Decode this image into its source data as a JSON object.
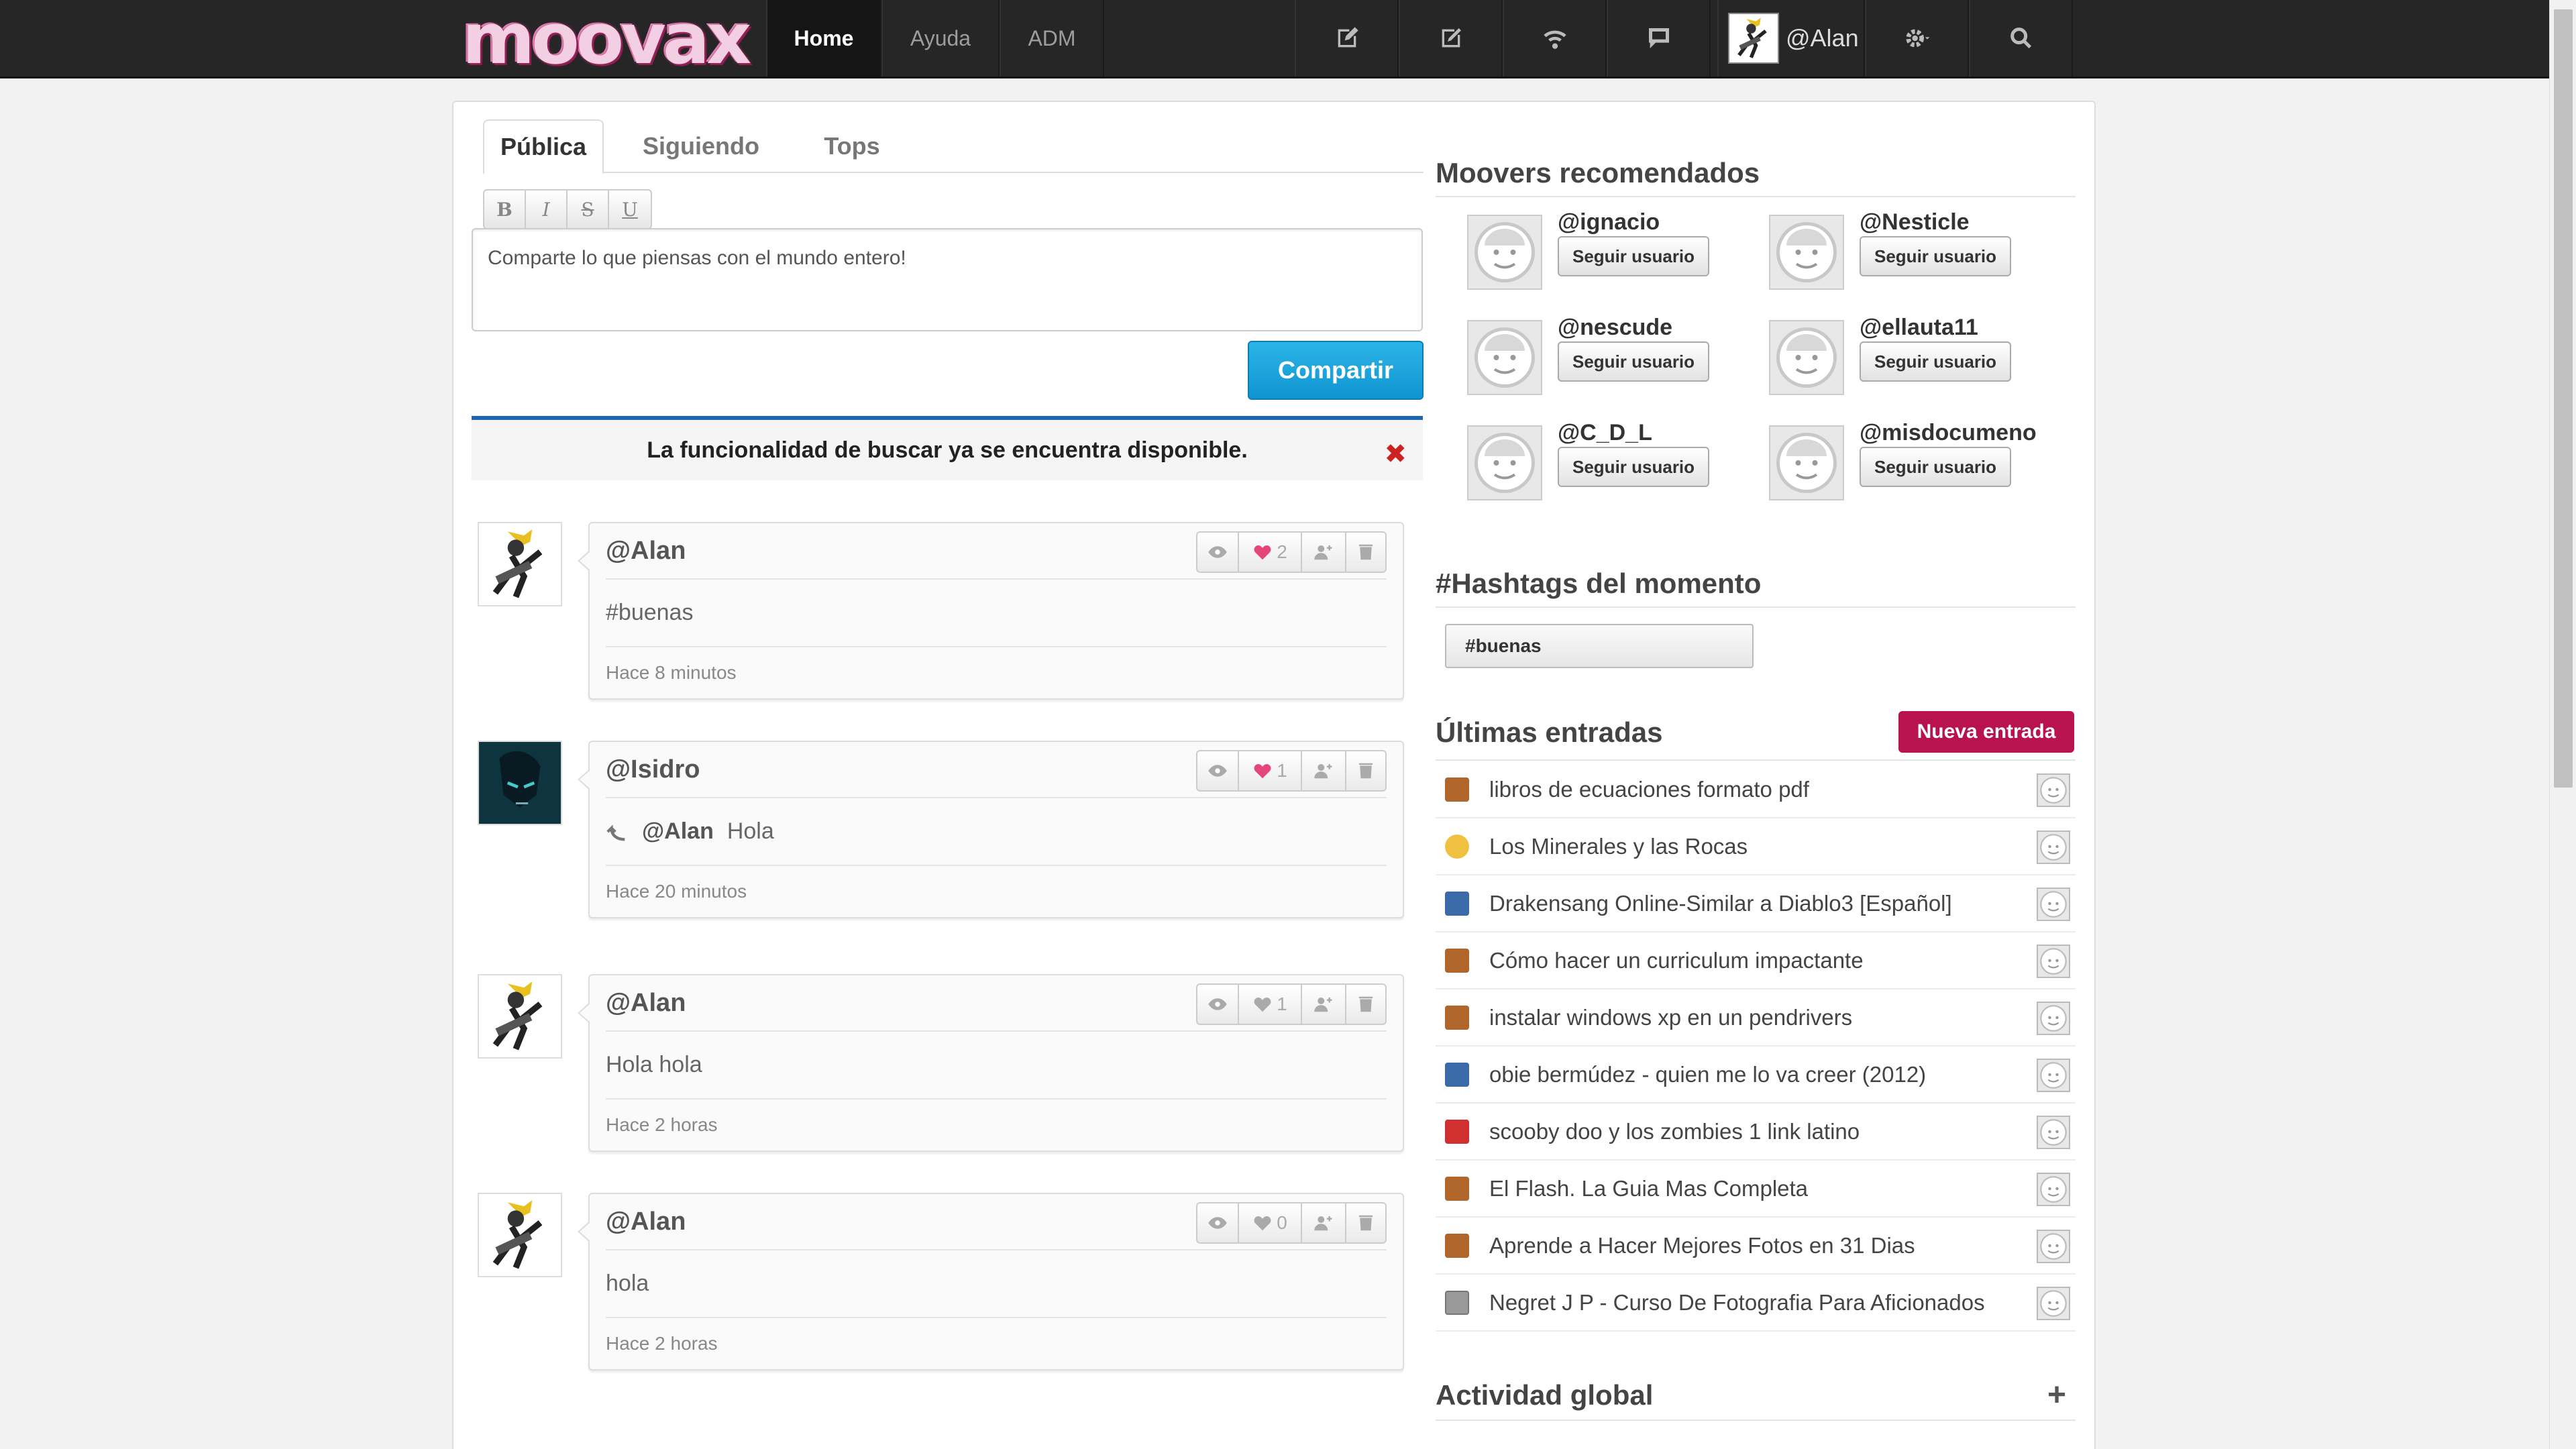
{
  "topbar": {
    "logo": "moovax",
    "nav": [
      "Home",
      "Ayuda",
      "ADM"
    ],
    "user": "@Alan",
    "icons": [
      "compose-icon",
      "edit-icon",
      "wifi-icon",
      "chat-icon",
      "gear-icon",
      "search-icon"
    ]
  },
  "tabs": [
    "Pública",
    "Siguiendo",
    "Tops"
  ],
  "composer": {
    "format": [
      "B",
      "I",
      "S",
      "U"
    ],
    "placeholder": "Comparte lo que piensas con el mundo entero!",
    "share": "Compartir"
  },
  "notice": {
    "text": "La funcionalidad de buscar ya se encuentra disponible.",
    "close": "✖"
  },
  "posts": [
    {
      "user": "@Alan",
      "likes": "2",
      "body": "#buenas",
      "time": "Hace 8 minutos"
    },
    {
      "user": "@Isidro",
      "likes": "1",
      "reply_to": "@Alan",
      "body": "Hola",
      "time": "Hace 20 minutos"
    },
    {
      "user": "@Alan",
      "likes": "1",
      "body": "Hola hola",
      "time": "Hace 2 horas"
    },
    {
      "user": "@Alan",
      "likes": "0",
      "body": "hola",
      "time": "Hace 2 horas"
    }
  ],
  "sidebar": {
    "movers_title": "Moovers recomendados",
    "follow_label": "Seguir usuario",
    "movers": [
      "@ignacio",
      "@Nesticle",
      "@nescude",
      "@ellauta11",
      "@C_D_L",
      "@misdocumeno"
    ],
    "hashtags_title": "#Hashtags del momento",
    "hashtags": [
      "#buenas"
    ],
    "entries_title": "Últimas entradas",
    "new_entry": "Nueva entrada",
    "entries": [
      {
        "title": "libros de ecuaciones formato pdf",
        "icon": "book-icon",
        "color": "#b0652a"
      },
      {
        "title": "Los Minerales y las Rocas",
        "icon": "speech-icon",
        "color": "#f0c040"
      },
      {
        "title": "Drakensang Online-Similar a Diablo3 [Español]",
        "icon": "film-icon",
        "color": "#3a6aa8"
      },
      {
        "title": "Cómo hacer un curriculum impactante",
        "icon": "book-icon",
        "color": "#b0652a"
      },
      {
        "title": "instalar windows xp en un pendrivers",
        "icon": "book-icon",
        "color": "#b0652a"
      },
      {
        "title": "obie bermúdez - quien me lo va creer (2012)",
        "icon": "film-icon",
        "color": "#3a6aa8"
      },
      {
        "title": "scooby doo y los zombies 1 link latino",
        "icon": "game-icon",
        "color": "#d03030"
      },
      {
        "title": "El Flash. La Guia Mas Completa",
        "icon": "book-icon",
        "color": "#b0652a"
      },
      {
        "title": "Aprende a Hacer Mejores Fotos en 31 Dias",
        "icon": "book-icon",
        "color": "#b0652a"
      },
      {
        "title": "Negret J P - Curso De Fotografia Para Aficionados",
        "icon": "document-icon",
        "color": "#999999"
      }
    ],
    "activity_title": "Actividad global",
    "activity_plus": "+"
  }
}
